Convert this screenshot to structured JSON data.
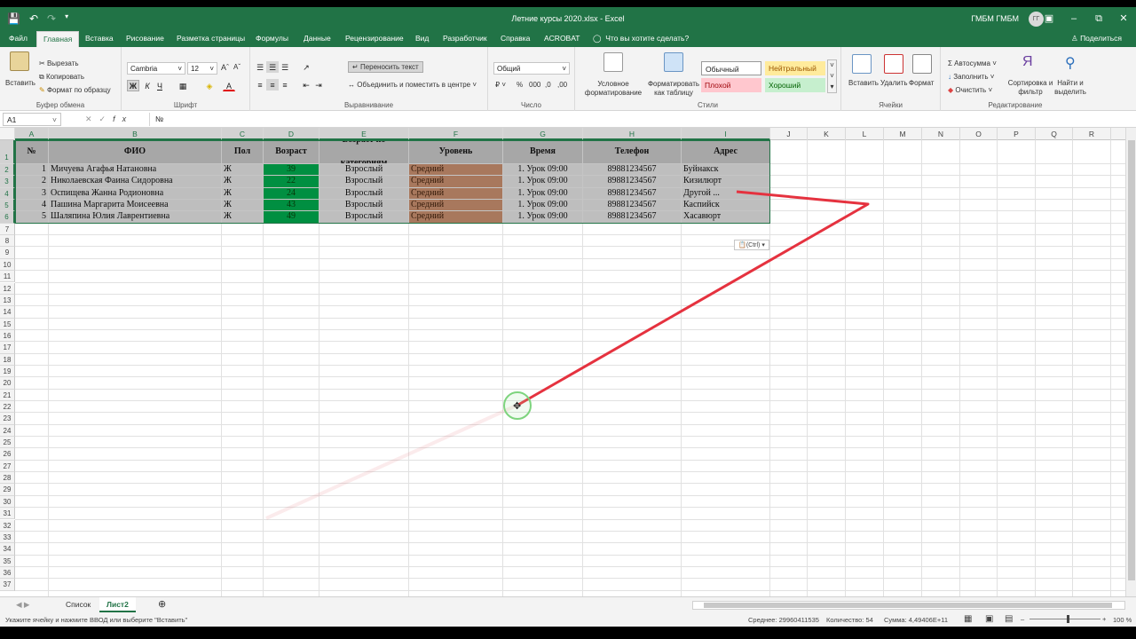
{
  "titlebar": {
    "title": "Летние курсы 2020.xlsx  -  Excel",
    "user": "ГМБМ ГМБМ",
    "avatar": "ГГ"
  },
  "tabs": [
    "Файл",
    "Главная",
    "Вставка",
    "Рисование",
    "Разметка страницы",
    "Формулы",
    "Данные",
    "Рецензирование",
    "Вид",
    "Разработчик",
    "Справка",
    "ACROBAT"
  ],
  "active_tab": "Главная",
  "tellme": "Что вы хотите сделать?",
  "share": "Поделиться",
  "ribbon": {
    "clipboard": {
      "paste": "Вставить",
      "cut": "Вырезать",
      "copy": "Копировать",
      "format_painter": "Формат по образцу",
      "label": "Буфер обмена"
    },
    "font": {
      "name": "Cambria",
      "size": "12",
      "label": "Шрифт"
    },
    "alignment": {
      "wrap": "Переносить текст",
      "merge": "Объединить и поместить в центре",
      "label": "Выравнивание"
    },
    "number": {
      "format": "Общий",
      "label": "Число"
    },
    "styles": {
      "cond": "Условное форматирование",
      "table": "Форматировать как таблицу",
      "normal": "Обычный",
      "neutral": "Нейтральный",
      "bad": "Плохой",
      "good": "Хороший",
      "label": "Стили"
    },
    "cells": {
      "insert": "Вставить",
      "delete": "Удалить",
      "format": "Формат",
      "label": "Ячейки"
    },
    "editing": {
      "autosum": "Автосумма",
      "fill": "Заполнить",
      "clear": "Очистить",
      "sort": "Сортировка и фильтр",
      "find": "Найти и выделить",
      "label": "Редактирование"
    }
  },
  "formula_bar": {
    "namebox": "A1",
    "formula": "№"
  },
  "columns": [
    "A",
    "B",
    "C",
    "D",
    "E",
    "F",
    "G",
    "H",
    "I",
    "J",
    "K",
    "L",
    "M",
    "N",
    "O",
    "P",
    "Q",
    "R"
  ],
  "table": {
    "headers": [
      "№",
      "ФИО",
      "Пол",
      "Возраст",
      "Возраст по категориям",
      "Уровень",
      "Время",
      "Телефон",
      "Адрес"
    ],
    "rows": [
      [
        "1",
        "Мичуева Агафья Натановна",
        "Ж",
        "39",
        "Взрослый",
        "Средний",
        "1. Урок 09:00",
        "89881234567",
        "Буйнакск"
      ],
      [
        "2",
        "Николаевская Фаина Сидоровна",
        "Ж",
        "22",
        "Взрослый",
        "Средний",
        "1. Урок 09:00",
        "89881234567",
        "Кизилюрт"
      ],
      [
        "3",
        "Оспищева Жанна Родионовна",
        "Ж",
        "24",
        "Взрослый",
        "Средний",
        "1. Урок 09:00",
        "89881234567",
        "Другой ..."
      ],
      [
        "4",
        "Пашина Маргарита Моисеевна",
        "Ж",
        "43",
        "Взрослый",
        "Средний",
        "1. Урок 09:00",
        "89881234567",
        "Каспийск"
      ],
      [
        "5",
        "Шаляпина Юлия Лаврентиевна",
        "Ж",
        "49",
        "Взрослый",
        "Средний",
        "1. Урок 09:00",
        "89881234567",
        "Хасавюрт"
      ]
    ]
  },
  "paste_badge": "(Ctrl)",
  "sheets": [
    "Список",
    "Лист2"
  ],
  "active_sheet": "Лист2",
  "status": {
    "hint": "Укажите ячейку и нажмите ВВОД или выберите \"Вставить\"",
    "average": "Среднее: 29960411535",
    "count": "Количество: 54",
    "sum": "Сумма: 4,49406E+11",
    "zoom": "100 %"
  },
  "colors": {
    "excel_green": "#217346",
    "age_fill": "#00a34a",
    "level_fill": "#c0896a",
    "header_fill": "#bfbfbf"
  }
}
